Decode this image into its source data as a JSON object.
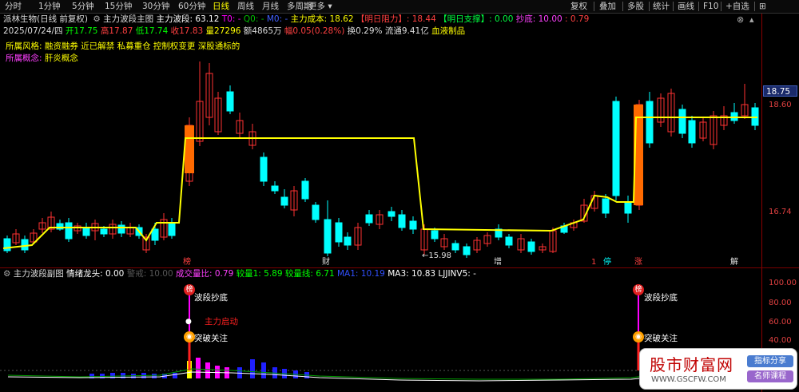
{
  "tabs": {
    "left": [
      "分时",
      "1分钟",
      "5分钟",
      "15分钟",
      "30分钟",
      "60分钟",
      "日线",
      "周线",
      "月线",
      "多周期",
      "更多"
    ],
    "active": "日线",
    "right": [
      "复权",
      "叠加",
      "多股",
      "统计",
      "画线",
      "F10",
      "+自选",
      "⊞"
    ]
  },
  "header": {
    "stock_name": "派林生物(日线 前复权)",
    "indicator_name": "主力波段主图",
    "wave_label": "主力波段: 63.12",
    "t0": "T0: -",
    "q0": "Q0: -",
    "m0": "M0: -",
    "cost": "主力成本: 18.62",
    "resistance": "【明日阻力】: 18.44",
    "support": "【明日支撑】: 0.00",
    "bottom": "抄底: 10.00",
    "extra": ": 0.79"
  },
  "quote": {
    "date": "2025/07/24/四",
    "open": "开17.75",
    "high": "高17.87",
    "low": "低17.74",
    "close": "收17.83",
    "volume": "量27296",
    "amount": "额4865万",
    "change": "幅0.05(0.28%)",
    "turnover": "换0.29%",
    "float": "流通9.41亿",
    "sector": "血液制品"
  },
  "style": {
    "label": "所属风格:",
    "value": "融资融券 近已解禁 私募重仓 控制权变更 深股通标的"
  },
  "concept": {
    "label": "所属概念:",
    "value": "肝炎概念"
  },
  "price_axis": {
    "labels": [
      "18.75",
      "18.60",
      "16.74"
    ],
    "current": "18.75"
  },
  "low_marker": "←15.98",
  "event_markers": [
    "榜",
    "财",
    "增",
    "1",
    "停",
    "涨",
    "解"
  ],
  "sub_header": {
    "title": "主力波段副图",
    "emotion": "情绪龙头: 0.00",
    "alert": "警戒: 10.00",
    "vol_ratio": "成交量比: 0.79",
    "vol1": "较量1: 5.89",
    "vol2": "较量线: 6.71",
    "ma1": "MA1: 10.19",
    "ma3": "MA3: 10.83",
    "ljjinv": "LJJINV5: -"
  },
  "sub_axis": [
    "100.00",
    "80.00",
    "60.00",
    "40.00"
  ],
  "signals": {
    "bottom_label": "波段抄底",
    "start_label": "主力启动",
    "breakout_label": "突破关注",
    "bang": "榜"
  },
  "watermark": {
    "logo": "股市财富网",
    "url": "WWW.GSCFW.COM",
    "btn1": "指标分享",
    "btn2": "名师课程"
  },
  "colors": {
    "up": "#ff3232",
    "down": "#00ffff",
    "cost_line": "#ffff00",
    "axis": "#8b0000",
    "magenta": "#ff00ff",
    "blue": "#2020ff"
  }
}
